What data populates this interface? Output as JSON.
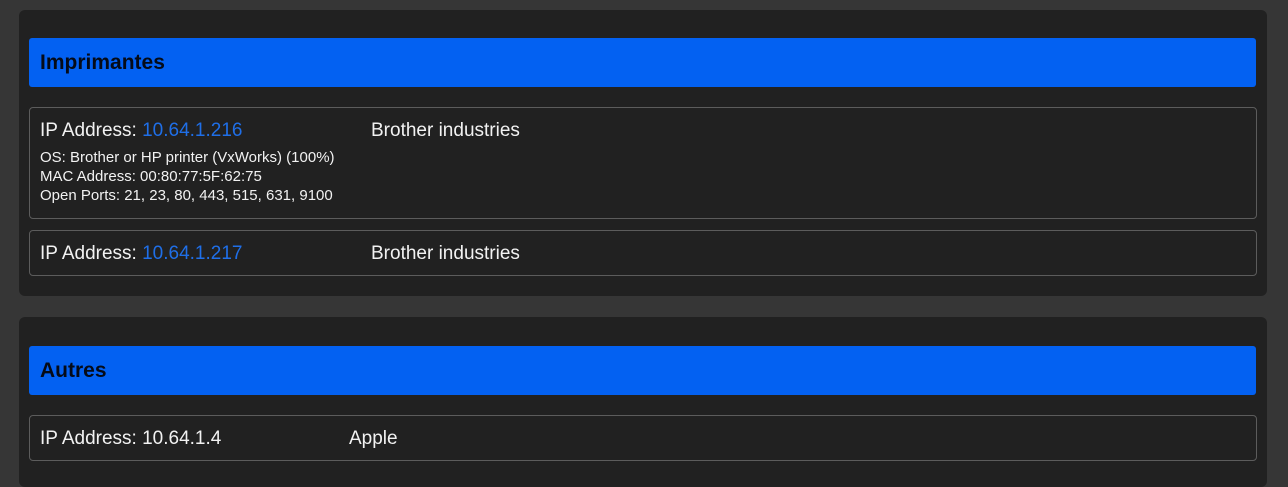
{
  "sections": [
    {
      "title": "Imprimantes",
      "devices": [
        {
          "ip_label": "IP Address: ",
          "ip": "10.64.1.216",
          "vendor": "Brother industries",
          "os": "OS: Brother or HP printer (VxWorks) (100%)",
          "mac": "MAC Address: 00:80:77:5F:62:75",
          "ports": "Open Ports: 21, 23, 80, 443, 515, 631, 9100"
        },
        {
          "ip_label": "IP Address: ",
          "ip": "10.64.1.217",
          "vendor": "Brother industries"
        }
      ]
    },
    {
      "title": "Autres",
      "devices": [
        {
          "ip_label": "IP Address: ",
          "ip": "10.64.1.4",
          "vendor": "Apple"
        }
      ]
    }
  ],
  "colors": {
    "page_background": "#363636",
    "panel_background": "#212121",
    "header_accent": "#0361f2",
    "ip_link": "#1f6fe8",
    "text": "#f2f2f2"
  }
}
